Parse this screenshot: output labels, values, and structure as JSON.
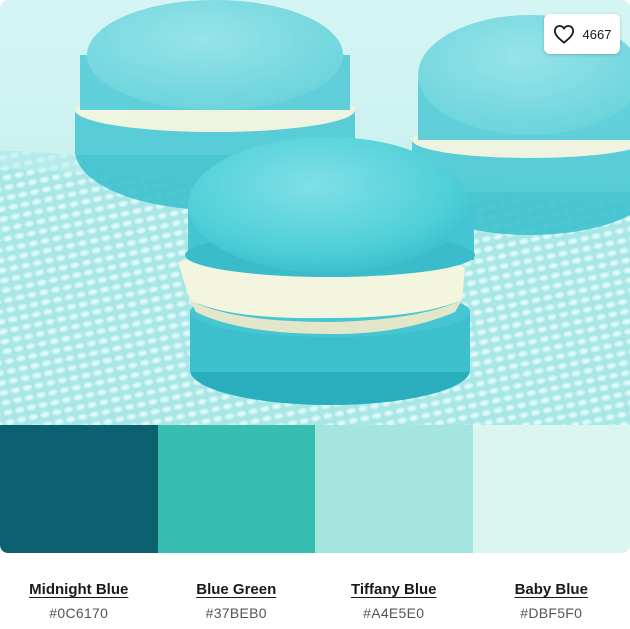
{
  "like": {
    "count": "4667",
    "icon": "heart-outline-icon"
  },
  "palette": [
    {
      "name": "Midnight Blue",
      "hex": "#0C6170"
    },
    {
      "name": "Blue Green",
      "hex": "#37BEB0"
    },
    {
      "name": "Tiffany Blue",
      "hex": "#A4E5E0"
    },
    {
      "name": "Baby Blue",
      "hex": "#DBF5F0"
    }
  ],
  "photo": {
    "subject": "macarons-photo",
    "colors": {
      "background": "#c9f1ef",
      "cloth": "#a6e6e6",
      "shell": "#4fcfd8",
      "shell_shadow": "#2eb5c4",
      "cream": "#f3f3dc"
    }
  }
}
